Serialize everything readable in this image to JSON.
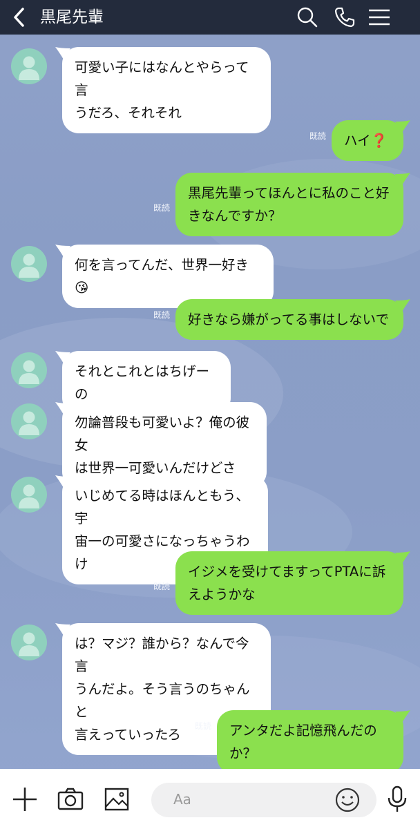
{
  "header": {
    "title": "黒尾先輩"
  },
  "messages": [
    {
      "side": "in",
      "text": "可愛い子にはなんとやらって言\nうだろ、それそれ"
    },
    {
      "side": "out",
      "text": "ハイ❓",
      "read": "既読"
    },
    {
      "side": "out",
      "text": "黒尾先輩ってほんとに私のこと好\nきなんですか？",
      "read": "既読"
    },
    {
      "side": "in",
      "text": "何を言ってんだ、世界一好き😘"
    },
    {
      "side": "out",
      "text": "好きなら嫌がってる事はしないで",
      "read": "既読"
    },
    {
      "side": "in",
      "text": "それとこれとはちげーの"
    },
    {
      "side": "in",
      "text": "勿論普段も可愛いよ？俺の彼女\nは世界一可愛いんだけどさ"
    },
    {
      "side": "in",
      "text": "いじめてる時はほんともう、宇\n宙一の可愛さになっちゃうわけ"
    },
    {
      "side": "out",
      "text": "イジメを受けてますってPTAに訴\nえようかな",
      "read": "既読"
    },
    {
      "side": "in",
      "text": "は？マジ？誰から？なんで今言\nうんだよ。そう言うのちゃんと\n言えっていったろ"
    },
    {
      "side": "out",
      "text": "アンタだよ記憶飛んだのか？",
      "read": "既読"
    }
  ],
  "input": {
    "placeholder": "Aa"
  },
  "icons": {
    "back": "chevron-left-icon",
    "search": "search-icon",
    "call": "phone-icon",
    "menu": "menu-icon",
    "plus": "plus-icon",
    "camera": "camera-icon",
    "image": "image-icon",
    "emoji": "emoji-icon",
    "mic": "microphone-icon"
  },
  "colors": {
    "header": "#232b3c",
    "incoming": "#ffffff",
    "outgoing": "#8be04e",
    "avatar": "#8fd0bd"
  }
}
